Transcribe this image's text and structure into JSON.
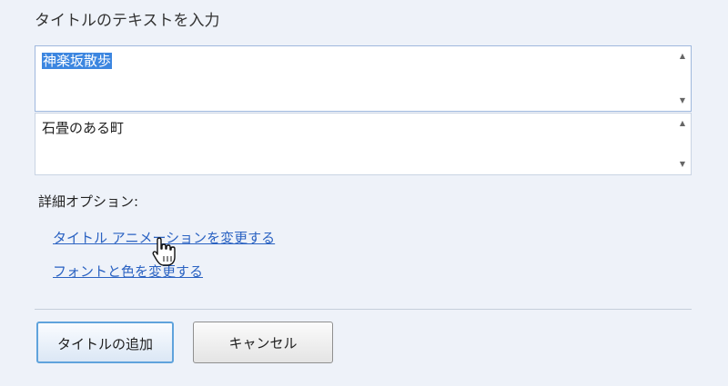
{
  "heading": "タイトルのテキストを入力",
  "title_lines": [
    {
      "text": "神楽坂散歩",
      "selected": true
    },
    {
      "text": "石畳のある町",
      "selected": false
    }
  ],
  "options": {
    "label": "詳細オプション:",
    "links": [
      "タイトル アニメーションを変更する",
      "フォントと色を変更する"
    ]
  },
  "buttons": {
    "add": "タイトルの追加",
    "cancel": "キャンセル"
  },
  "icons": {
    "scroll_up": "scroll-up-arrow-icon",
    "scroll_down": "scroll-down-arrow-icon",
    "cursor": "hand-pointer-cursor-icon"
  },
  "colors": {
    "background": "#eef2f9",
    "selection": "#3c86e0",
    "link": "#2a62c2",
    "primary_button_border": "#5fa3dc"
  }
}
